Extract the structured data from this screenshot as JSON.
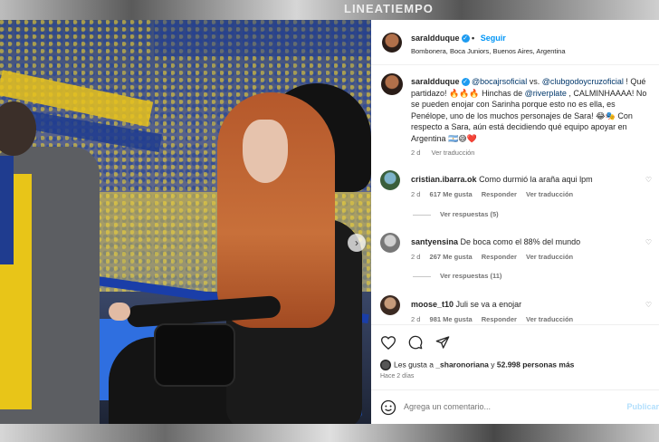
{
  "backdrop": {
    "top_text": "LINEATIEMPO"
  },
  "post": {
    "username": "saraldduque",
    "follow_label": "Seguir",
    "location": "Bombonera, Boca Juniors, Buenos Aires, Argentina",
    "caption": {
      "username": "saraldduque",
      "mention1": "@bocajrsoficial",
      "vs": " vs. ",
      "mention2": "@clubgodoycruzoficial",
      "part1": " ! Qué partidazo! 🔥🔥🔥 Hinchas de ",
      "mention3": "@riverplate",
      "part2": " , CALMINHAAAA! No se pueden enojar con Sarinha porque esto no es ella, es Penélope, uno de los muchos personajes de Sara! 😂🎭 Con respecto a Sara, aún está decidiendo qué equipo apoyar en Argentina 🇦🇷😅❤️",
      "time": "2 d",
      "translate": "Ver traducción"
    },
    "comments": [
      {
        "username": "cristian.ibarra.ok",
        "text": "Como durmió la araña aqui lpm",
        "time": "2 d",
        "likes": "617 Me gusta",
        "reply": "Responder",
        "translate": "Ver traducción",
        "replies": "Ver respuestas (5)"
      },
      {
        "username": "santyensina",
        "text": "De boca como el 88% del mundo",
        "time": "2 d",
        "likes": "267 Me gusta",
        "reply": "Responder",
        "translate": "Ver traducción",
        "replies": "Ver respuestas (11)"
      },
      {
        "username": "moose_t10",
        "text": "Juli se va a enojar",
        "time": "2 d",
        "likes": "981 Me gusta",
        "reply": "Responder",
        "translate": "Ver traducción"
      }
    ],
    "likes": {
      "prefix": "Les gusta a ",
      "user": "_sharonoriana",
      "mid": " y ",
      "count": "52.998 personas más"
    },
    "posted": "Hace 2 días",
    "comment_placeholder": "Agrega un comentario...",
    "publish_label": "Publicar"
  },
  "colors": {
    "accent": "#0095f6",
    "verified": "#1d9bf0",
    "mention": "#00376b"
  }
}
